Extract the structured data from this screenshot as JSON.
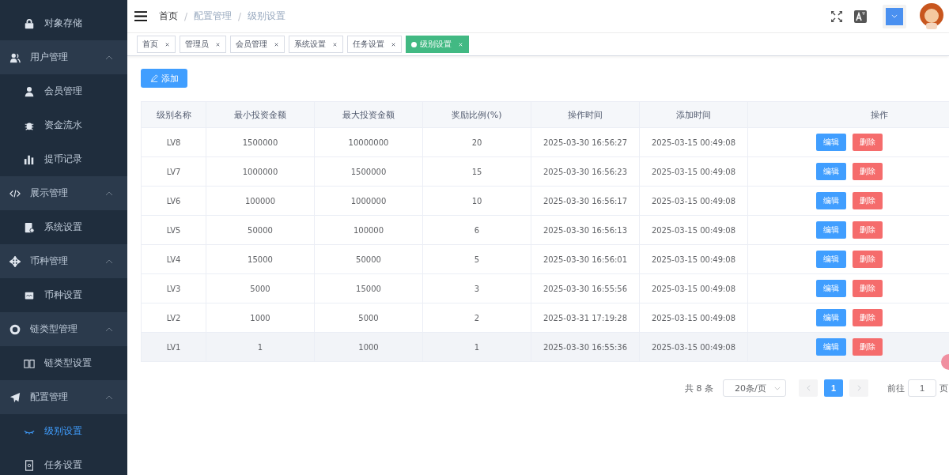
{
  "sidebar": {
    "items": [
      {
        "kind": "child",
        "label": "对象存储",
        "selected": false
      },
      {
        "kind": "group",
        "label": "用户管理",
        "expanded": true
      },
      {
        "kind": "child",
        "label": "会员管理",
        "selected": false
      },
      {
        "kind": "child",
        "label": "资金流水",
        "selected": false
      },
      {
        "kind": "child",
        "label": "提币记录",
        "selected": false
      },
      {
        "kind": "group",
        "label": "展示管理",
        "expanded": true
      },
      {
        "kind": "child",
        "label": "系统设置",
        "selected": false
      },
      {
        "kind": "group",
        "label": "币种管理",
        "expanded": true
      },
      {
        "kind": "child",
        "label": "币种设置",
        "selected": false
      },
      {
        "kind": "group",
        "label": "链类型管理",
        "expanded": true
      },
      {
        "kind": "child",
        "label": "链类型设置",
        "selected": false
      },
      {
        "kind": "group",
        "label": "配置管理",
        "expanded": true
      },
      {
        "kind": "child",
        "label": "级别设置",
        "selected": true
      },
      {
        "kind": "child",
        "label": "任务设置",
        "selected": false
      }
    ]
  },
  "breadcrumb": {
    "separator": "/",
    "items": [
      "首页",
      "配置管理",
      "级别设置"
    ]
  },
  "tags": [
    {
      "label": "首页",
      "selected": false
    },
    {
      "label": "管理员",
      "selected": false
    },
    {
      "label": "会员管理",
      "selected": false
    },
    {
      "label": "系统设置",
      "selected": false
    },
    {
      "label": "任务设置",
      "selected": false
    },
    {
      "label": "级别设置",
      "selected": true
    }
  ],
  "add_button": "添加",
  "table": {
    "columns": [
      "级别名称",
      "最小投资金额",
      "最大投资金额",
      "奖励比例(%)",
      "操作时间",
      "添加时间",
      "操作"
    ],
    "rows": [
      {
        "cells": [
          "LV8",
          "1500000",
          "10000000",
          "20",
          "2025-03-30 16:56:27",
          "2025-03-15 00:49:08"
        ],
        "edit": "编辑",
        "delete": "删除",
        "hovered": false
      },
      {
        "cells": [
          "LV7",
          "1000000",
          "1500000",
          "15",
          "2025-03-30 16:56:23",
          "2025-03-15 00:49:08"
        ],
        "edit": "编辑",
        "delete": "删除",
        "hovered": false
      },
      {
        "cells": [
          "LV6",
          "100000",
          "1000000",
          "10",
          "2025-03-30 16:56:17",
          "2025-03-15 00:49:08"
        ],
        "edit": "编辑",
        "delete": "删除",
        "hovered": false
      },
      {
        "cells": [
          "LV5",
          "50000",
          "100000",
          "6",
          "2025-03-30 16:56:13",
          "2025-03-15 00:49:08"
        ],
        "edit": "编辑",
        "delete": "删除",
        "hovered": false
      },
      {
        "cells": [
          "LV4",
          "15000",
          "50000",
          "5",
          "2025-03-30 16:56:01",
          "2025-03-15 00:49:08"
        ],
        "edit": "编辑",
        "delete": "删除",
        "hovered": false
      },
      {
        "cells": [
          "LV3",
          "5000",
          "15000",
          "3",
          "2025-03-30 16:55:56",
          "2025-03-15 00:49:08"
        ],
        "edit": "编辑",
        "delete": "删除",
        "hovered": false
      },
      {
        "cells": [
          "LV2",
          "1000",
          "5000",
          "2",
          "2025-03-31 17:19:28",
          "2025-03-15 00:49:08"
        ],
        "edit": "编辑",
        "delete": "删除",
        "hovered": false
      },
      {
        "cells": [
          "LV1",
          "1",
          "1000",
          "1",
          "2025-03-30 16:55:36",
          "2025-03-15 00:49:08"
        ],
        "edit": "编辑",
        "delete": "删除",
        "hovered": true
      }
    ]
  },
  "pagination": {
    "total": "共 8 条",
    "page_size": "20条/页",
    "pages": [
      {
        "label": "1",
        "selected": true
      }
    ],
    "goto_label": "前往",
    "goto_value": "1",
    "page_suffix": "页"
  }
}
